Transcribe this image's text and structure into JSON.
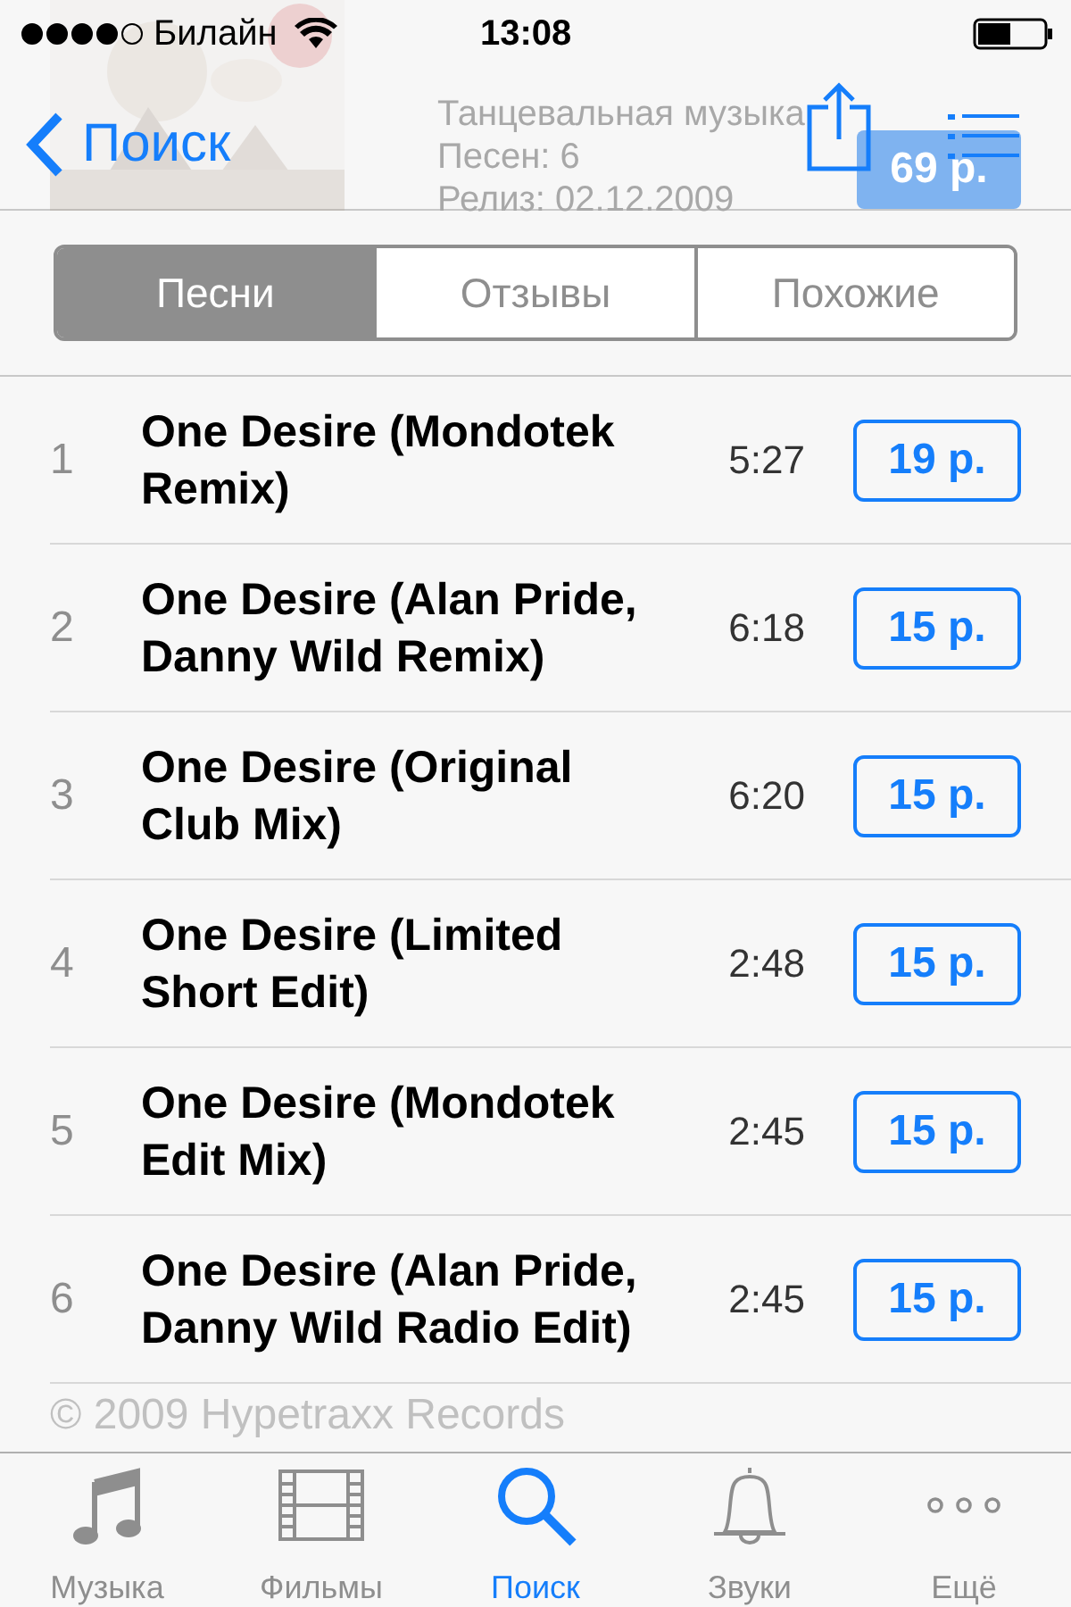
{
  "status_bar": {
    "carrier": "Билайн",
    "time": "13:08"
  },
  "header": {
    "genre": "Танцевальная музыка",
    "track_count": "Песен: 6",
    "release": "Релиз: 02.12.2009",
    "price": "69 р."
  },
  "nav_bar": {
    "back": "Поиск"
  },
  "segments": [
    {
      "label": "Песни",
      "selected": true
    },
    {
      "label": "Отзывы",
      "selected": false
    },
    {
      "label": "Похожие",
      "selected": false
    }
  ],
  "tracks": [
    {
      "number": "1",
      "title": "One Desire (Mondotek Remix)",
      "duration": "5:27",
      "price": "19 р."
    },
    {
      "number": "2",
      "title": "One Desire (Alan Pride, Danny Wild Remix)",
      "duration": "6:18",
      "price": "15 р."
    },
    {
      "number": "3",
      "title": "One Desire (Original Club Mix)",
      "duration": "6:20",
      "price": "15 р."
    },
    {
      "number": "4",
      "title": "One Desire (Limited Short Edit)",
      "duration": "2:48",
      "price": "15 р."
    },
    {
      "number": "5",
      "title": "One Desire (Mondotek Edit Mix)",
      "duration": "2:45",
      "price": "15 р."
    },
    {
      "number": "6",
      "title": "One Desire (Alan Pride, Danny Wild Radio Edit)",
      "duration": "2:45",
      "price": "15 р."
    }
  ],
  "copyright": "© 2009 Hypetraxx Records",
  "tab_bar": [
    {
      "kind": "music",
      "label": "Музыка",
      "selected": false
    },
    {
      "kind": "films",
      "label": "Фильмы",
      "selected": false
    },
    {
      "kind": "search",
      "label": "Поиск",
      "selected": true
    },
    {
      "kind": "sounds",
      "label": "Звуки",
      "selected": false
    },
    {
      "kind": "more",
      "label": "Ещё",
      "selected": false
    }
  ]
}
